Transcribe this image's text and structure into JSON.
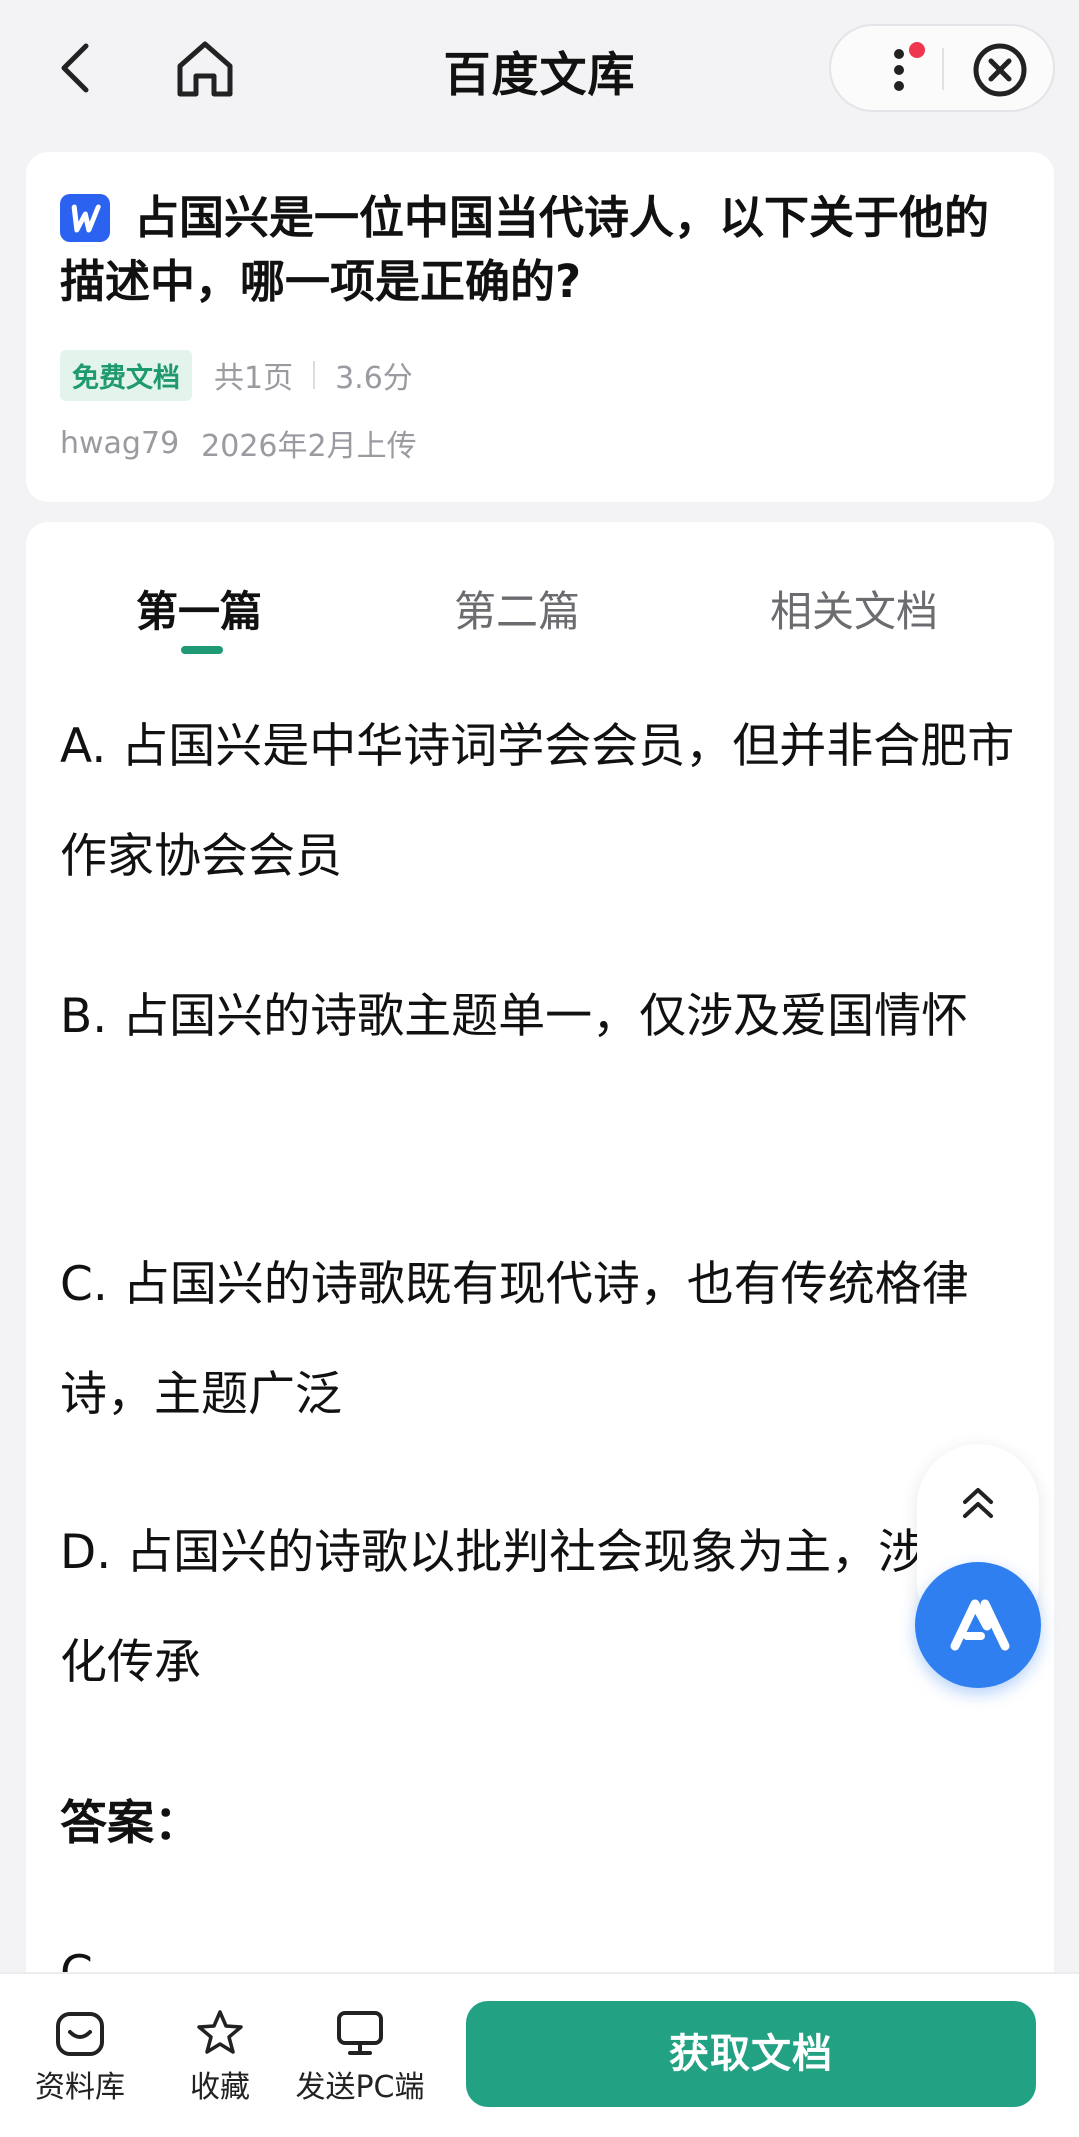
{
  "header": {
    "title": "百度文库",
    "back_icon": "chevron-left-icon",
    "home_icon": "home-icon",
    "more_icon": "more-vertical-icon",
    "close_icon": "close-circle-icon",
    "notification_dot_color": "#f0364f"
  },
  "document": {
    "title": "占国兴是一位中国当代诗人，以下关于他的描述中，哪一项是正确的?",
    "badge": "免费文档",
    "pages": "共1页",
    "score": "3.6分",
    "uploader": "hwag79",
    "upload_date": "2026年2月上传",
    "file_type_icon": "word-doc-icon"
  },
  "tabs": [
    {
      "label": "第一篇",
      "active": true
    },
    {
      "label": "第二篇",
      "active": false
    },
    {
      "label": "相关文档",
      "active": false
    }
  ],
  "content": {
    "option_a": "A. 占国兴是中华诗词学会会员，但并非合肥市作家协会会员",
    "option_b": "B. 占国兴的诗歌主题单一，仅涉及爱国情怀",
    "option_c": "C. 占国兴的诗歌既有现代诗，也有传统格律诗，主题广泛",
    "option_d": "D. 占国兴的诗歌以批判社会现象为主，涉及文化传承",
    "answer_label": "答案：",
    "answer_value": "C"
  },
  "floating": {
    "scroll_top_icon": "double-chevron-up-icon",
    "ai_icon": "ai-assistant-icon"
  },
  "bottom_bar": {
    "library_label": "资料库",
    "favorite_label": "收藏",
    "send_pc_label": "发送PC端",
    "get_doc_label": "获取文档"
  },
  "colors": {
    "accent_green": "#23a283",
    "ai_blue": "#2f7ff0",
    "word_blue": "#2b62f0"
  }
}
